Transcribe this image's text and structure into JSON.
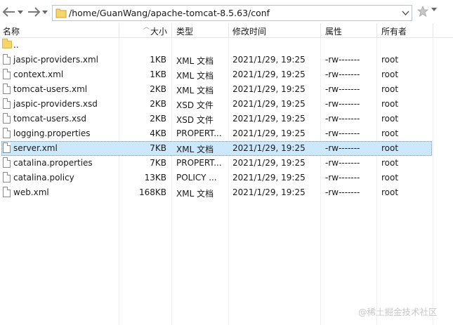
{
  "toolbar": {
    "path": "/home/GuanWang/apache-tomcat-8.5.63/conf"
  },
  "columns": {
    "name": "名称",
    "size": "大小",
    "type": "类型",
    "modified": "修改时间",
    "attributes": "属性",
    "owner": "所有者"
  },
  "parent": {
    "name": ".."
  },
  "files": [
    {
      "name": "jaspic-providers.xml",
      "size": "1KB",
      "type": "XML 文档",
      "modified": "2021/1/29, 19:25",
      "attributes": "-rw-------",
      "owner": "root"
    },
    {
      "name": "context.xml",
      "size": "1KB",
      "type": "XML 文档",
      "modified": "2021/1/29, 19:25",
      "attributes": "-rw-------",
      "owner": "root"
    },
    {
      "name": "tomcat-users.xml",
      "size": "2KB",
      "type": "XML 文档",
      "modified": "2021/1/29, 19:25",
      "attributes": "-rw-------",
      "owner": "root"
    },
    {
      "name": "jaspic-providers.xsd",
      "size": "2KB",
      "type": "XSD 文件",
      "modified": "2021/1/29, 19:25",
      "attributes": "-rw-------",
      "owner": "root"
    },
    {
      "name": "tomcat-users.xsd",
      "size": "2KB",
      "type": "XSD 文件",
      "modified": "2021/1/29, 19:25",
      "attributes": "-rw-------",
      "owner": "root"
    },
    {
      "name": "logging.properties",
      "size": "4KB",
      "type": "PROPERT...",
      "modified": "2021/1/29, 19:25",
      "attributes": "-rw-------",
      "owner": "root"
    },
    {
      "name": "server.xml",
      "size": "7KB",
      "type": "XML 文档",
      "modified": "2021/1/29, 19:25",
      "attributes": "-rw-------",
      "owner": "root"
    },
    {
      "name": "catalina.properties",
      "size": "7KB",
      "type": "PROPERT...",
      "modified": "2021/1/29, 19:25",
      "attributes": "-rw-------",
      "owner": "root"
    },
    {
      "name": "catalina.policy",
      "size": "13KB",
      "type": "POLICY ...",
      "modified": "2021/1/29, 19:25",
      "attributes": "-rw-------",
      "owner": "root"
    },
    {
      "name": "web.xml",
      "size": "168KB",
      "type": "XML 文档",
      "modified": "2021/1/29, 19:25",
      "attributes": "-rw-------",
      "owner": "root"
    }
  ],
  "selected_file": "server.xml",
  "watermark": "@稀土掘金技术社区"
}
